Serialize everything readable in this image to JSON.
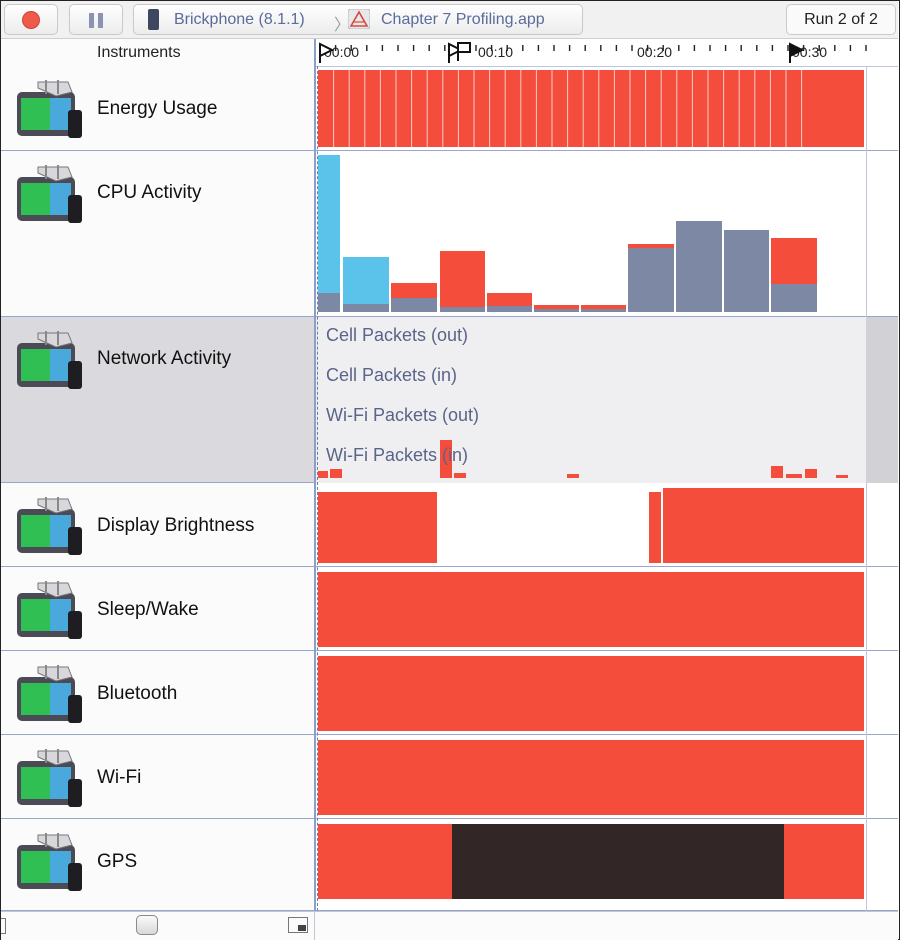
{
  "toolbar": {
    "device": "Brickphone (8.1.1)",
    "separator": "〉",
    "app": "Chapter 7 Profiling.app",
    "run": "Run 2 of 2"
  },
  "sidebar": {
    "header": "Instruments",
    "rows": [
      {
        "label": "Energy Usage"
      },
      {
        "label": "CPU Activity"
      },
      {
        "label": "Network Activity"
      },
      {
        "label": "Display Brightness"
      },
      {
        "label": "Sleep/Wake"
      },
      {
        "label": "Bluetooth"
      },
      {
        "label": "Wi-Fi"
      },
      {
        "label": "GPS"
      }
    ]
  },
  "ruler": {
    "ticks": [
      "00:00",
      "00:10",
      "00:20",
      "00:30"
    ]
  },
  "network": {
    "series": [
      "Cell Packets (out)",
      "Cell Packets (in)",
      "Wi-Fi Packets (out)",
      "Wi-Fi Packets (in)"
    ]
  },
  "colors": {
    "red": "#f44d3c",
    "blue": "#5bc2ea",
    "slate": "#7c88a4",
    "dark": "#332626"
  }
}
